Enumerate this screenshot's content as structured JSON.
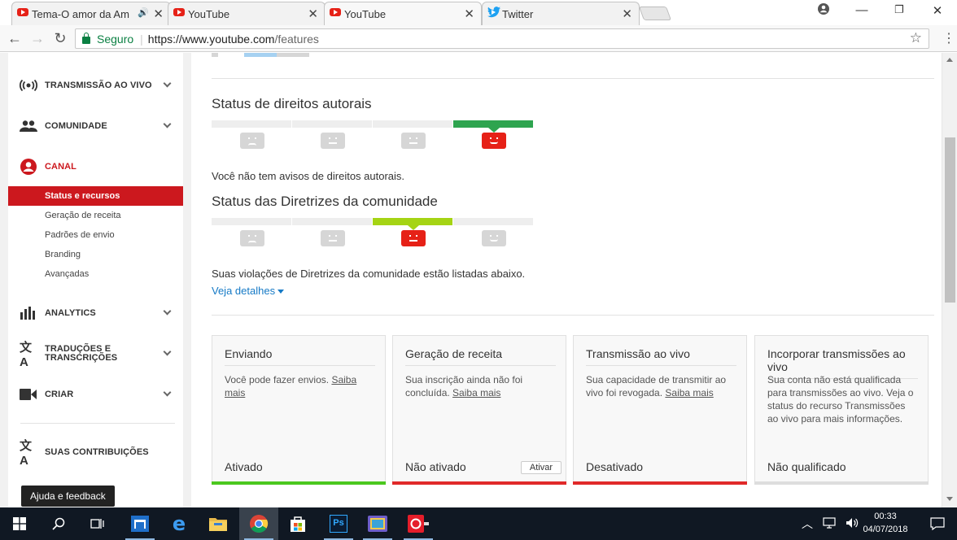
{
  "browser": {
    "tabs": [
      {
        "title": "Tema-O amor da Ami",
        "icon": "youtube-icon"
      },
      {
        "title": "YouTube",
        "icon": "youtube-icon"
      },
      {
        "title": "YouTube",
        "icon": "youtube-icon",
        "active": true
      },
      {
        "title": "Twitter",
        "icon": "twitter-icon"
      }
    ],
    "security_label": "Seguro",
    "url_host": "https://www.youtube.com",
    "url_path": "/features"
  },
  "sidebar": {
    "items": [
      {
        "label": "TRANSMISSÃO AO VIVO",
        "icon": "broadcast-icon"
      },
      {
        "label": "COMUNIDADE",
        "icon": "people-icon"
      },
      {
        "label": "CANAL",
        "icon": "account-circle-icon"
      },
      {
        "label": "ANALYTICS",
        "icon": "bar-chart-icon"
      },
      {
        "label": "TRADUÇÕES E TRANSCRIÇÕES",
        "icon": "translate-icon"
      },
      {
        "label": "CRIAR",
        "icon": "video-camera-icon"
      },
      {
        "label": "SUAS CONTRIBUIÇÕES",
        "icon": "translate-icon"
      }
    ],
    "subitems": [
      {
        "label": "Status e recursos",
        "active": true
      },
      {
        "label": "Geração de receita"
      },
      {
        "label": "Padrões de envio"
      },
      {
        "label": "Branding"
      },
      {
        "label": "Avançadas"
      }
    ],
    "tooltip": "Ajuda e feedback"
  },
  "copyright": {
    "title": "Status de direitos autorais",
    "message": "Você não tem avisos de direitos autorais.",
    "active_index": 3,
    "active_color": "#2ea44f"
  },
  "community": {
    "title": "Status das Diretrizes da comunidade",
    "message": "Suas violações de Diretrizes da comunidade estão listadas abaixo.",
    "details_link": "Veja detalhes",
    "active_index": 2,
    "active_color": "#a5d414"
  },
  "features": [
    {
      "title": "Enviando",
      "desc": "Você pode fazer envios.",
      "link": "Saiba mais",
      "status": "Ativado",
      "bar_color": "#4bc81f"
    },
    {
      "title": "Geração de receita",
      "desc": "Sua inscrição ainda não foi concluída.",
      "link": "Saiba mais",
      "status": "Não ativado",
      "button": "Ativar",
      "bar_color": "#e02929"
    },
    {
      "title": "Transmissão ao vivo",
      "desc": "Sua capacidade de transmitir ao vivo foi revogada.",
      "link": "Saiba mais",
      "status": "Desativado",
      "bar_color": "#e02929"
    },
    {
      "title": "Incorporar transmissões ao vivo",
      "desc": "Sua conta não está qualificada para transmissões ao vivo. Veja o status do recurso Transmissões ao vivo para mais informações.",
      "link": "",
      "status": "Não qualificado",
      "bar_color": "#dddddd"
    }
  ],
  "taskbar": {
    "time": "00:33",
    "date": "04/07/2018",
    "apps": [
      "start-icon",
      "search-icon",
      "task-view-icon",
      "store-app-icon",
      "edge-icon",
      "file-explorer-icon",
      "chrome-icon",
      "windows-store-icon",
      "photoshop-icon",
      "media-app-icon",
      "red-app-icon"
    ]
  }
}
